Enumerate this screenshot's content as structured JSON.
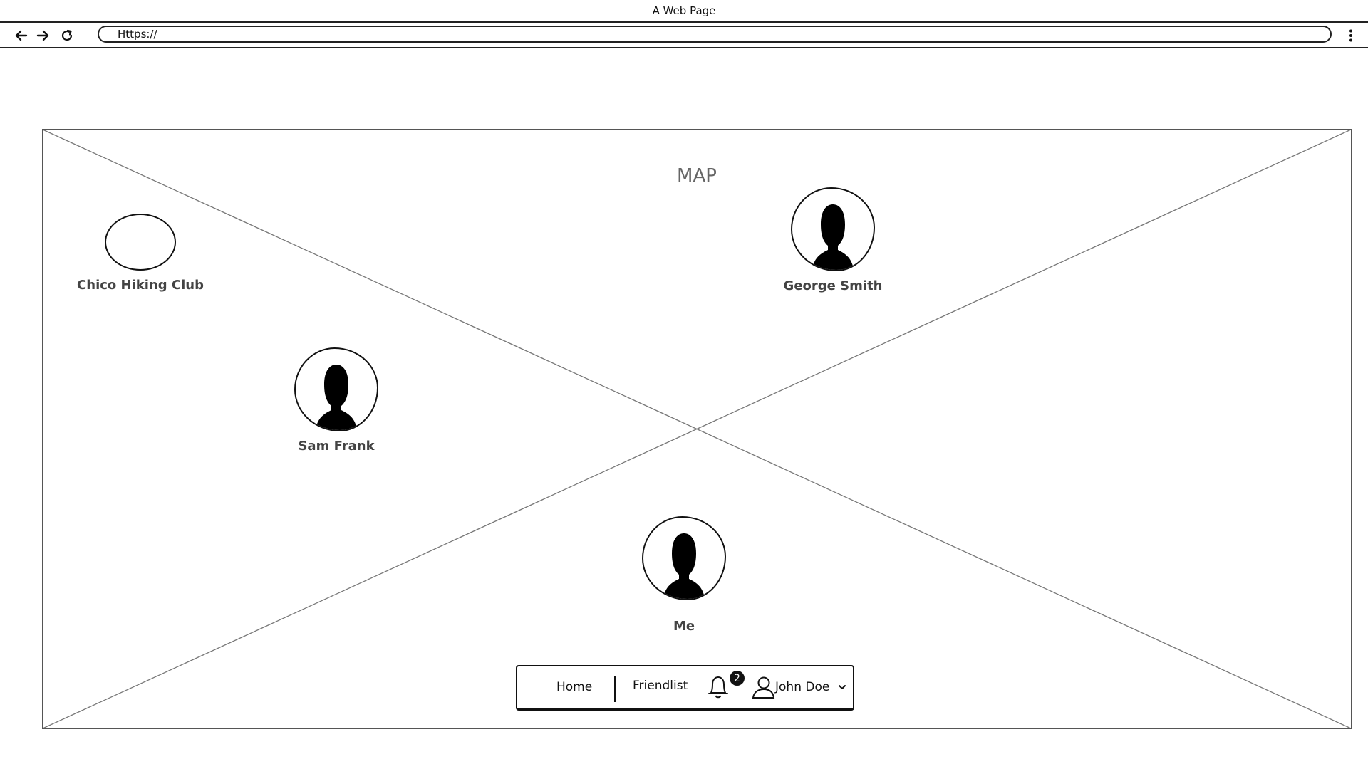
{
  "window": {
    "title": "A Web Page"
  },
  "browser": {
    "url": "Https://",
    "icons": {
      "back": "arrow-left-icon",
      "forward": "arrow-right-icon",
      "reload": "reload-icon",
      "menu": "kebab-menu-icon"
    }
  },
  "map": {
    "title": "MAP",
    "markers": {
      "club": {
        "label": "Chico Hiking Club"
      },
      "george": {
        "label": "George Smith"
      },
      "sam": {
        "label": "Sam Frank"
      },
      "me": {
        "label": "Me"
      }
    }
  },
  "nav": {
    "home_label": "Home",
    "friendlist_label": "Friendlist",
    "notification_count": "2",
    "user_name": "John Doe"
  }
}
